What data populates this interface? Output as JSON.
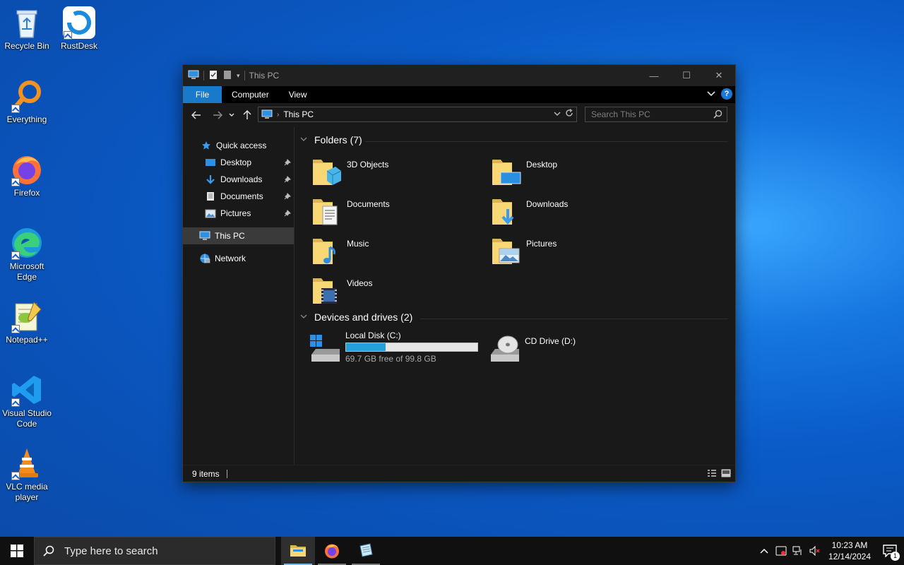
{
  "desktop": {
    "icons": [
      {
        "label": "Recycle Bin",
        "icon": "recycle-bin-icon"
      },
      {
        "label": "RustDesk",
        "icon": "rustdesk-icon"
      },
      {
        "label": "Everything",
        "icon": "everything-search-icon"
      },
      {
        "label": "Firefox",
        "icon": "firefox-icon"
      },
      {
        "label": "Microsoft Edge",
        "icon": "edge-icon"
      },
      {
        "label": "Notepad++",
        "icon": "notepad-plus-plus-icon"
      },
      {
        "label": "Visual Studio Code",
        "icon": "vscode-icon"
      },
      {
        "label": "VLC media player",
        "icon": "vlc-icon"
      }
    ]
  },
  "window": {
    "title": "This PC",
    "controls": {
      "minimize": "—",
      "maximize": "☐",
      "close": "✕"
    },
    "ribbon_tabs": [
      "File",
      "Computer",
      "View"
    ],
    "help": "?",
    "address": {
      "path": "This PC"
    },
    "search": {
      "placeholder": "Search This PC"
    },
    "nav_pane": {
      "quick_access": "Quick access",
      "quick_items": [
        {
          "label": "Desktop",
          "pinned": true
        },
        {
          "label": "Downloads",
          "pinned": true
        },
        {
          "label": "Documents",
          "pinned": true
        },
        {
          "label": "Pictures",
          "pinned": true
        }
      ],
      "this_pc": "This PC",
      "network": "Network"
    },
    "folders_group": "Folders (7)",
    "folders": [
      "3D Objects",
      "Desktop",
      "Documents",
      "Downloads",
      "Music",
      "Pictures",
      "Videos"
    ],
    "drives_group": "Devices and drives (2)",
    "drives": [
      {
        "name": "Local Disk (C:)",
        "free_text": "69.7 GB free of 99.8 GB",
        "used_fraction": 0.302
      },
      {
        "name": "CD Drive (D:)"
      }
    ],
    "status": {
      "items": "9 items"
    }
  },
  "taskbar": {
    "search_placeholder": "Type here to search",
    "apps": [
      "file-explorer-icon",
      "firefox-icon",
      "notepad-icon"
    ],
    "clock": {
      "time": "10:23 AM",
      "date": "12/14/2024"
    },
    "notifications": "1"
  },
  "colors": {
    "accent": "#1979ca",
    "drive_bar": "#26a0da",
    "window_bg": "#191919"
  }
}
